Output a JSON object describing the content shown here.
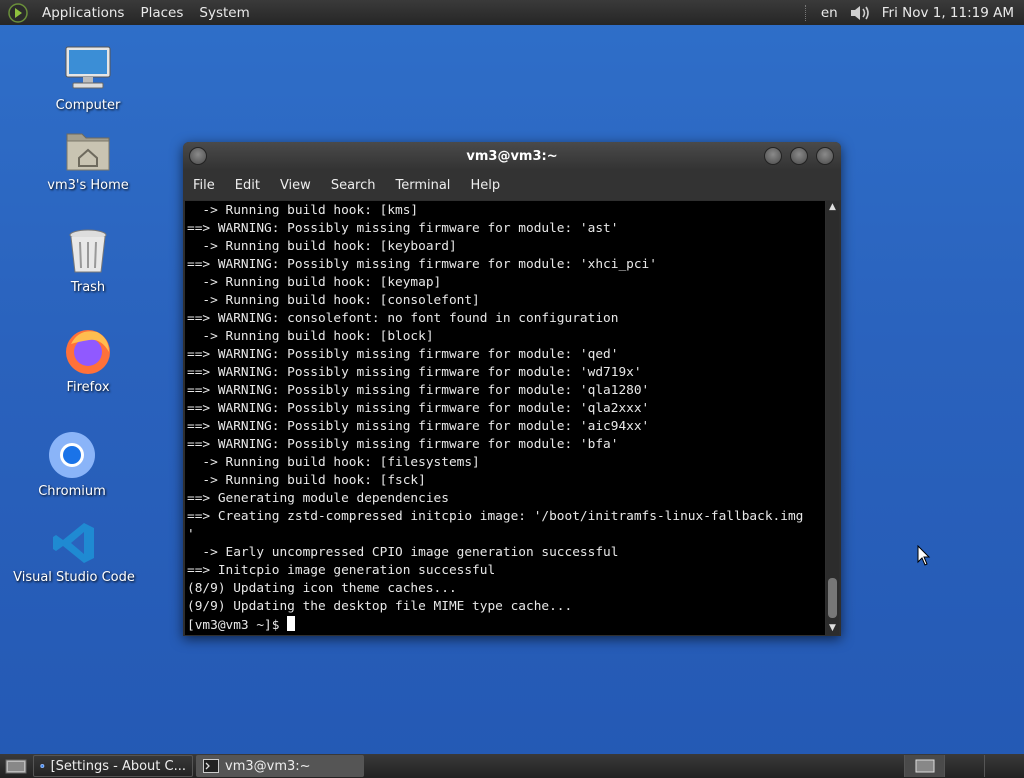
{
  "top_panel": {
    "menus": [
      "Applications",
      "Places",
      "System"
    ],
    "language": "en",
    "clock": "Fri Nov 1, 11:19 AM",
    "volume_icon": "speaker-icon"
  },
  "desktop_icons": [
    {
      "label": "Computer",
      "icon": "computer-icon"
    },
    {
      "label": "vm3's Home",
      "icon": "home-folder-icon"
    },
    {
      "label": "Trash",
      "icon": "trash-icon"
    },
    {
      "label": "Firefox",
      "icon": "firefox-icon"
    },
    {
      "label": "Chromium",
      "icon": "chromium-icon"
    },
    {
      "label": "Visual Studio Code",
      "icon": "vscode-icon"
    }
  ],
  "terminal_window": {
    "title": "vm3@vm3:~",
    "menu": [
      "File",
      "Edit",
      "View",
      "Search",
      "Terminal",
      "Help"
    ],
    "lines": [
      "  -> Running build hook: [kms]",
      "==> WARNING: Possibly missing firmware for module: 'ast'",
      "  -> Running build hook: [keyboard]",
      "==> WARNING: Possibly missing firmware for module: 'xhci_pci'",
      "  -> Running build hook: [keymap]",
      "  -> Running build hook: [consolefont]",
      "==> WARNING: consolefont: no font found in configuration",
      "  -> Running build hook: [block]",
      "==> WARNING: Possibly missing firmware for module: 'qed'",
      "==> WARNING: Possibly missing firmware for module: 'wd719x'",
      "==> WARNING: Possibly missing firmware for module: 'qla1280'",
      "==> WARNING: Possibly missing firmware for module: 'qla2xxx'",
      "==> WARNING: Possibly missing firmware for module: 'aic94xx'",
      "==> WARNING: Possibly missing firmware for module: 'bfa'",
      "  -> Running build hook: [filesystems]",
      "  -> Running build hook: [fsck]",
      "==> Generating module dependencies",
      "==> Creating zstd-compressed initcpio image: '/boot/initramfs-linux-fallback.img",
      "'",
      "  -> Early uncompressed CPIO image generation successful",
      "==> Initcpio image generation successful",
      "(8/9) Updating icon theme caches...",
      "(9/9) Updating the desktop file MIME type cache..."
    ],
    "prompt": "[vm3@vm3 ~]$ "
  },
  "taskbar": {
    "tasks": [
      {
        "label": "[Settings - About C...",
        "icon": "chromium-icon",
        "active": false
      },
      {
        "label": "vm3@vm3:~",
        "icon": "terminal-icon",
        "active": true
      }
    ]
  }
}
